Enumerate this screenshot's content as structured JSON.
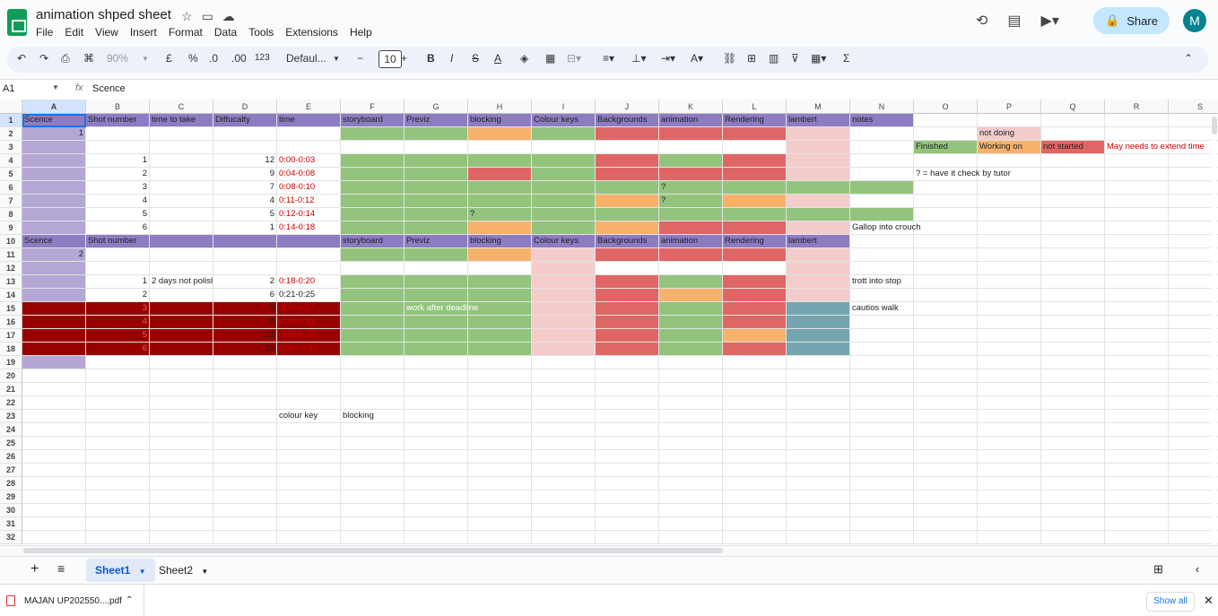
{
  "app": {
    "doc_title": "animation shped sheet",
    "menu": [
      "File",
      "Edit",
      "View",
      "Insert",
      "Format",
      "Data",
      "Tools",
      "Extensions",
      "Help"
    ],
    "share_label": "Share",
    "avatar_letter": "M"
  },
  "toolbar": {
    "zoom": "90%",
    "currency": "£",
    "percent": "%",
    "decimal_decrease": ".0",
    "decimal_increase": ".00",
    "number_format": "123",
    "font": "Defaul...",
    "font_size": "10"
  },
  "formula_bar": {
    "cell_ref": "A1",
    "fx": "fx",
    "value": "Scence"
  },
  "columns": [
    "A",
    "B",
    "C",
    "D",
    "E",
    "F",
    "G",
    "H",
    "I",
    "J",
    "K",
    "L",
    "M",
    "N",
    "O",
    "P",
    "Q",
    "R",
    "S"
  ],
  "rows": [
    "1",
    "2",
    "3",
    "4",
    "5",
    "6",
    "7",
    "8",
    "9",
    "10",
    "11",
    "12",
    "13",
    "14",
    "15",
    "16",
    "17",
    "18",
    "19",
    "20",
    "21",
    "22",
    "23",
    "24",
    "25",
    "26",
    "27",
    "28",
    "29",
    "30",
    "31",
    "32"
  ],
  "colors": {
    "purple_header": "#8e7cc3",
    "purple_light": "#b4a7d6",
    "green": "#93c47d",
    "red": "#e06666",
    "orange": "#f6b26b",
    "pink": "#f4cccc",
    "dark_red": "#990000",
    "teal": "#76a5af"
  },
  "cells": {
    "r1": [
      "Scence",
      "Shot number",
      "time to take",
      "Diffucalty",
      "time",
      "storyboard",
      "Previz",
      "blocking",
      "Colour keys",
      "Backgrounds",
      "animation",
      "Rendering",
      "lambert",
      "notes"
    ],
    "a2": "1",
    "p2": "not doing",
    "o3": "Finished",
    "p3": "Working on",
    "q3": "not started",
    "r3": "May needs to extend time t",
    "o5": "? = have it check by tutor",
    "b4": "1",
    "d4": "12",
    "e4": "0:00-0:03",
    "b5": "2",
    "d5": "9",
    "e5": "0:04-0:08",
    "b6": "3",
    "d6": "7",
    "e6": "0:08-0:10",
    "k6": "?",
    "b7": "4",
    "d7": "4",
    "e7": "0:11-0:12",
    "k7": "?",
    "b8": "5",
    "d8": "5",
    "e8": "0:12-0:14",
    "h8": "?",
    "b9": "6",
    "d9": "1",
    "e9": "0:14-0:18",
    "n9": "Gallop into crouch",
    "r10": [
      "Scence",
      "Shot number",
      "",
      "",
      "",
      "storyboard",
      "Previz",
      "blocking",
      "Colour keys",
      "Backgrounds",
      "animation",
      "Rendering",
      "lambert"
    ],
    "a11": "2",
    "b13": "1",
    "c13": "2 days not polish",
    "d13": "2",
    "e13": "0:18-0:20",
    "n13": "trott into stop",
    "b14": "2",
    "d14": "6",
    "e14": "0:21-0:25",
    "b15": "3",
    "d15": "3",
    "e15": "0:26-0:27",
    "g15": "work after deadline",
    "n15": "cautios walk",
    "b16": "4",
    "d16": "8",
    "e16": "0:28-0:31",
    "b17": "5",
    "d17": "11",
    "e17": "0:32-0:35",
    "b18": "6",
    "d18": "10",
    "e18": "0:36--0:40",
    "e23": "colour key",
    "f23": "blocking"
  },
  "sheets": [
    "Sheet1",
    "Sheet2"
  ],
  "download": {
    "filename": "MAJAN UP202550....pdf",
    "show_all": "Show all"
  }
}
